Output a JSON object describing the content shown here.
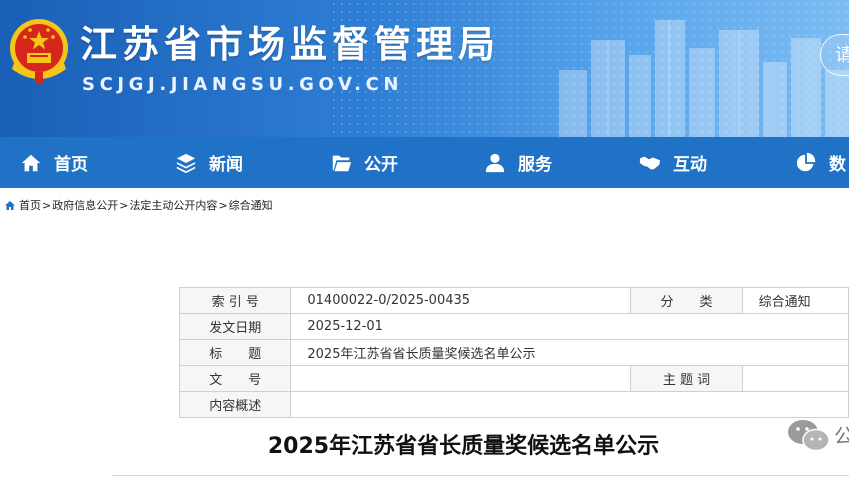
{
  "header": {
    "site_title": "江苏省市场监督管理局",
    "site_domain": "SCJGJ.JIANGSU.GOV.CN",
    "search_label": "请"
  },
  "nav": {
    "items": [
      {
        "label": "首页",
        "icon": "home-icon"
      },
      {
        "label": "新闻",
        "icon": "layers-icon"
      },
      {
        "label": "公开",
        "icon": "open-folder-icon"
      },
      {
        "label": "服务",
        "icon": "user-service-icon"
      },
      {
        "label": "互动",
        "icon": "handshake-icon"
      },
      {
        "label": "数",
        "icon": "pie-chart-icon"
      }
    ]
  },
  "breadcrumb": {
    "items": [
      "首页",
      "政府信息公开",
      "法定主动公开内容",
      "综合通知"
    ],
    "separator": ">"
  },
  "info_table": {
    "index_label": "索 引 号",
    "index_value": "01400022-0/2025-00435",
    "category_label": "分　　类",
    "category_value": "综合通知",
    "date_label": "发文日期",
    "date_value": "2025-12-01",
    "title_label": "标　　题",
    "title_value": "2025年江苏省省长质量奖候选名单公示",
    "docno_label": "文　　号",
    "docno_value": "",
    "keywords_label": "主 题 词",
    "keywords_value": "",
    "summary_label": "内容概述",
    "summary_value": ""
  },
  "article": {
    "title": "2025年江苏省省长质量奖候选名单公示"
  },
  "watermark": {
    "icon": "wechat-icon",
    "text": "公"
  },
  "colors": {
    "header_blue": "#1a5fb6",
    "nav_blue": "#1f72c6",
    "emblem_red": "#d7261c",
    "emblem_gold": "#f5c518"
  }
}
